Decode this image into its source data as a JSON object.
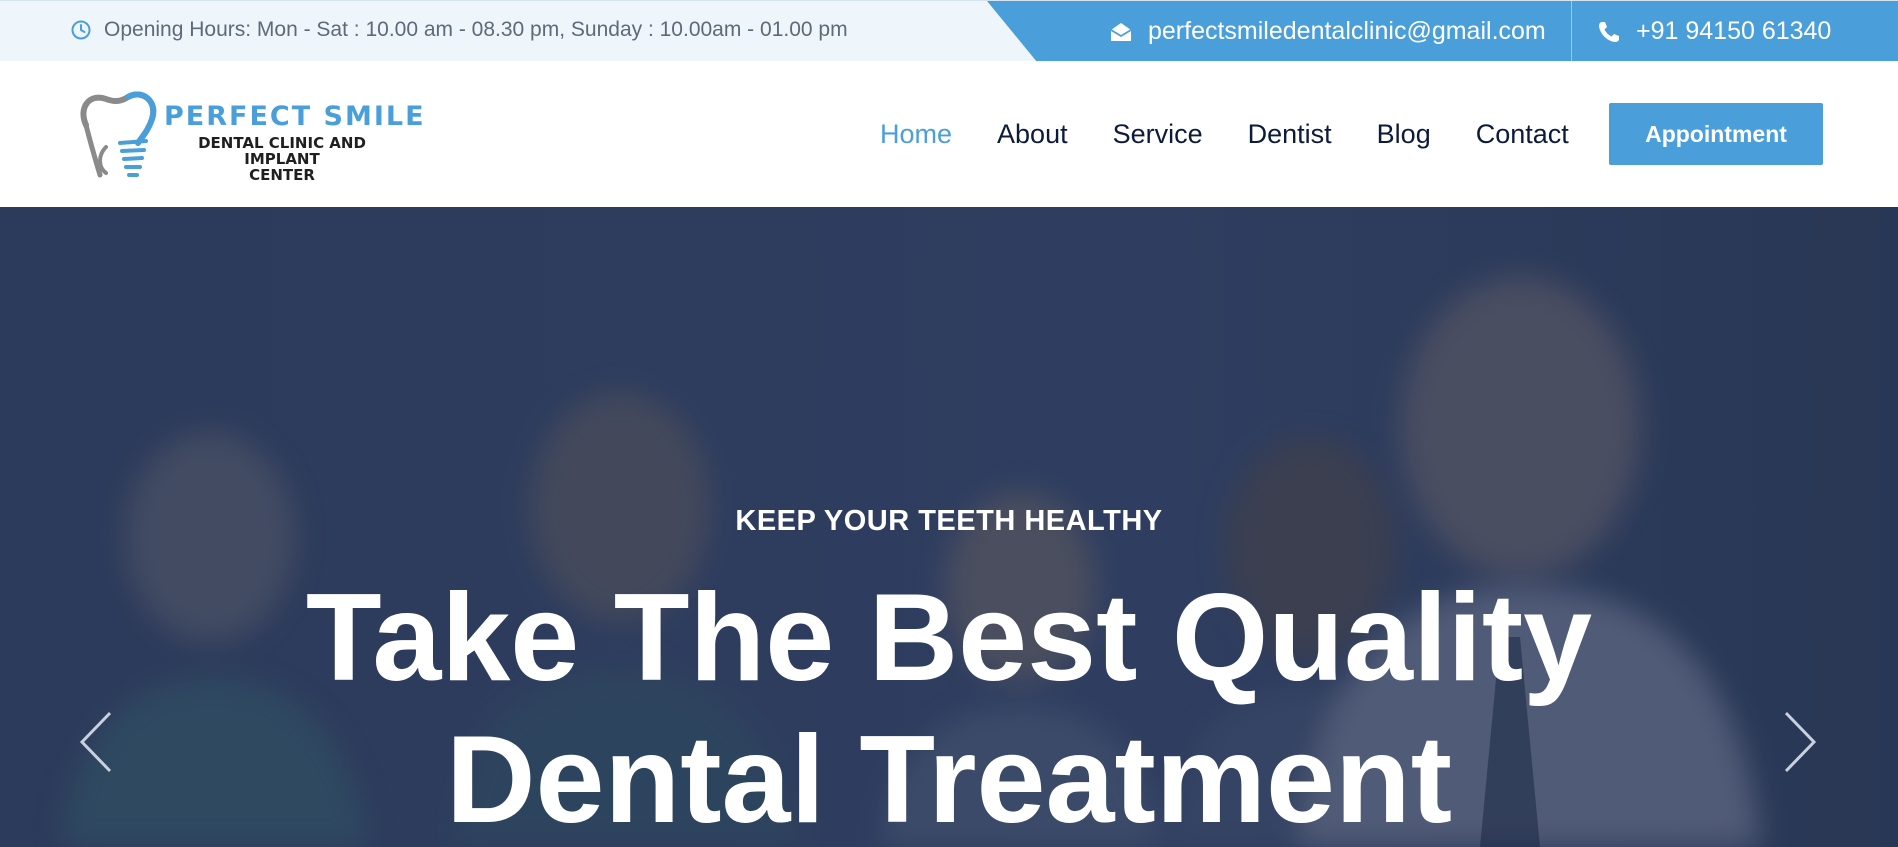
{
  "topbar": {
    "hours": "Opening Hours: Mon - Sat : 10.00 am - 08.30 pm, Sunday : 10.00am - 01.00 pm",
    "hours_icon": "clock-icon",
    "email": "perfectsmiledentalclinic@gmail.com",
    "email_icon": "envelope-icon",
    "phone": "+91 94150 61340",
    "phone_icon": "phone-icon"
  },
  "logo": {
    "title": "PERFECT SMILE",
    "subtitle_line1": "DENTAL CLINIC AND IMPLANT",
    "subtitle_line2": "CENTER"
  },
  "nav": {
    "items": [
      {
        "label": "Home",
        "active": true
      },
      {
        "label": "About",
        "active": false
      },
      {
        "label": "Service",
        "active": false
      },
      {
        "label": "Dentist",
        "active": false
      },
      {
        "label": "Blog",
        "active": false
      },
      {
        "label": "Contact",
        "active": false
      }
    ],
    "appointment_label": "Appointment"
  },
  "hero": {
    "eyebrow": "KEEP YOUR TEETH HEALTHY",
    "title_line1": "Take The Best Quality",
    "title_line2": "Dental Treatment",
    "prev_icon": "chevron-left-icon",
    "next_icon": "chevron-right-icon"
  },
  "colors": {
    "accent": "#4a9fdb",
    "nav_text": "#0c1b3a",
    "topbar_bg": "#eef5fb",
    "hero_overlay": "#2f3d5c"
  }
}
